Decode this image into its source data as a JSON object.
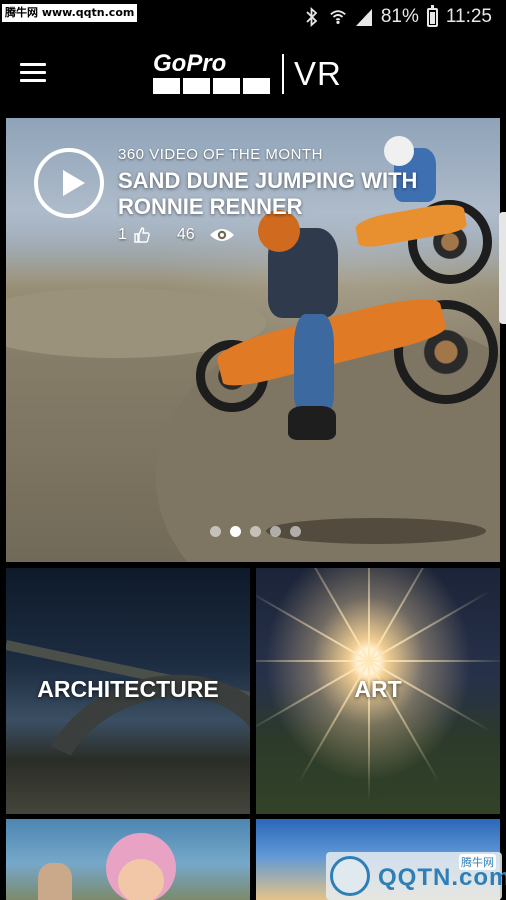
{
  "status_bar": {
    "watermark": "腾牛网 www.qqtn.com",
    "battery": "81%",
    "time": "11:25",
    "icons": [
      "bluetooth-icon",
      "wifi-icon",
      "signal-icon",
      "battery-icon"
    ]
  },
  "app_bar": {
    "logo_brand": "GoPro",
    "logo_product": "VR",
    "menu_icon": "hamburger-menu-icon"
  },
  "hero": {
    "kicker": "360 VIDEO OF THE MONTH",
    "title": "SAND DUNE JUMPING WITH RONNIE RENNER",
    "likes": "1",
    "views": "46",
    "carousel_pages": 5,
    "carousel_active": 2
  },
  "categories": [
    {
      "label": "ARCHITECTURE"
    },
    {
      "label": "ART"
    },
    {
      "label": ""
    },
    {
      "label": ""
    }
  ],
  "watermark_bottom": {
    "text": "QQTN.com",
    "badge": "腾牛网"
  }
}
